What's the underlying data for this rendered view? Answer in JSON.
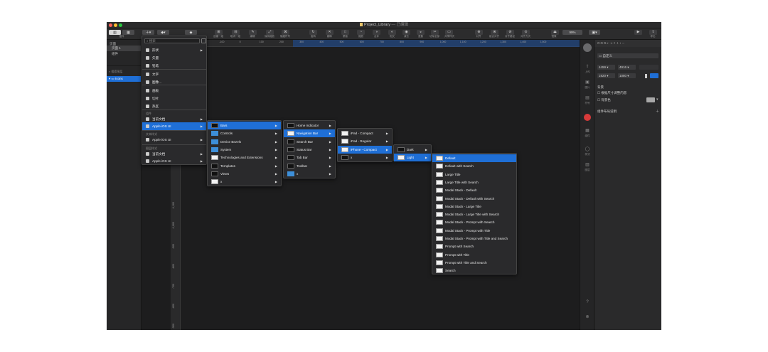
{
  "window": {
    "title": "Project_Library",
    "subtitle": " — 已编辑",
    "traffic_colors": [
      "#ff5f57",
      "#febc2e",
      "#28c840"
    ]
  },
  "toolbar": {
    "left_labels": [
      "插件"
    ],
    "group_labels": [
      "创建一组",
      "取消一组",
      "编辑",
      "保持缩放",
      "隐藏符号"
    ],
    "mid_labels": [
      "旋转",
      "翻转",
      "蒙版",
      "缩放",
      "合并",
      "相交",
      "减去",
      "差集",
      "切除全部",
      "共享样式"
    ],
    "right_labels": [
      "对齐",
      "组合对齐",
      "对齐路径",
      "对齐方式",
      "镜像",
      "导出"
    ],
    "zoom_value": "99%"
  },
  "sidebar": {
    "header": "页面",
    "pages": [
      "页面 1",
      "组件"
    ],
    "search_placeholder": "搜索图层",
    "selected_layer": "Icons"
  },
  "ruler": {
    "top_ticks": [
      "-300",
      "-200",
      "-100",
      "0",
      "100",
      "200",
      "300",
      "400",
      "500",
      "600",
      "700",
      "800",
      "900",
      "1,000",
      "1,100",
      "1,200",
      "1,300",
      "1,400",
      "1,500"
    ],
    "left_ticks": [
      "-1,100",
      "-1,000",
      "-900",
      "-800",
      "-700",
      "-600",
      "-500"
    ]
  },
  "right_strip": {
    "labels": [
      "上传",
      "图片",
      "符号",
      "组件",
      "样式",
      "图层"
    ]
  },
  "inspector": {
    "preset": "自定义",
    "w": "4459",
    "h": "4916",
    "x": "1920",
    "y": "1080",
    "section_bg": "背景",
    "check1": "根据尺寸调整内容",
    "check2": "背景色",
    "section_grid": "组件布局说明"
  },
  "menus": {
    "insert": {
      "search_placeholder": "搜索",
      "items": [
        {
          "icon": "shape-icon",
          "label": "形状",
          "arrow": true
        },
        {
          "icon": "vector-icon",
          "label": "矢量",
          "arrow": false
        },
        {
          "icon": "pencil-icon",
          "label": "铅笔",
          "arrow": false
        },
        {
          "icon": "text-icon",
          "label": "文字",
          "arrow": false
        },
        {
          "icon": "image-icon",
          "label": "图像...",
          "arrow": false
        },
        {
          "icon": "artboard-icon",
          "label": "画板",
          "arrow": false
        },
        {
          "icon": "slice-icon",
          "label": "切片",
          "arrow": false
        },
        {
          "icon": "hotspot-icon",
          "label": "热区",
          "arrow": false
        }
      ],
      "section1_head": "组件",
      "section1_items": [
        {
          "label": "当前文档",
          "arrow": true
        },
        {
          "label": "Apple iOS UI",
          "arrow": true,
          "selected": true
        }
      ],
      "section2_head": "文本样式",
      "section2_items": [
        {
          "label": "Apple iOS UI",
          "arrow": true
        }
      ],
      "section3_head": "图层样式",
      "section3_items": [
        {
          "label": "当前文档",
          "arrow": true
        },
        {
          "label": "Apple iOS UI",
          "arrow": true
        }
      ]
    },
    "level2": [
      "Bars",
      "Controls",
      "Device Bezels",
      "System",
      "Technologies and Extensions",
      "Templates",
      "Views",
      "x"
    ],
    "level3": [
      "Home Indicator",
      "Navigation Bar",
      "Search Bar",
      "Status Bar",
      "Tab Bar",
      "Toolbar",
      "x"
    ],
    "level4": [
      "iPad - Compact",
      "iPad - Regular",
      "iPhone - Compact",
      "x"
    ],
    "level5": [
      "Dark",
      "Light"
    ],
    "level6": [
      "Default",
      "Default with Search",
      "Large Title",
      "Large Title with Search",
      "Modal Stack - Default",
      "Modal Stack - Default with Search",
      "Modal Stack - Large Title",
      "Modal Stack - Large Title with Search",
      "Modal Stack - Prompt with Search",
      "Modal Stack - Prompt with Title",
      "Modal Stack - Prompt with Title and Search",
      "Prompt with Search",
      "Prompt with Title",
      "Prompt with Title and Search",
      "Search"
    ]
  }
}
